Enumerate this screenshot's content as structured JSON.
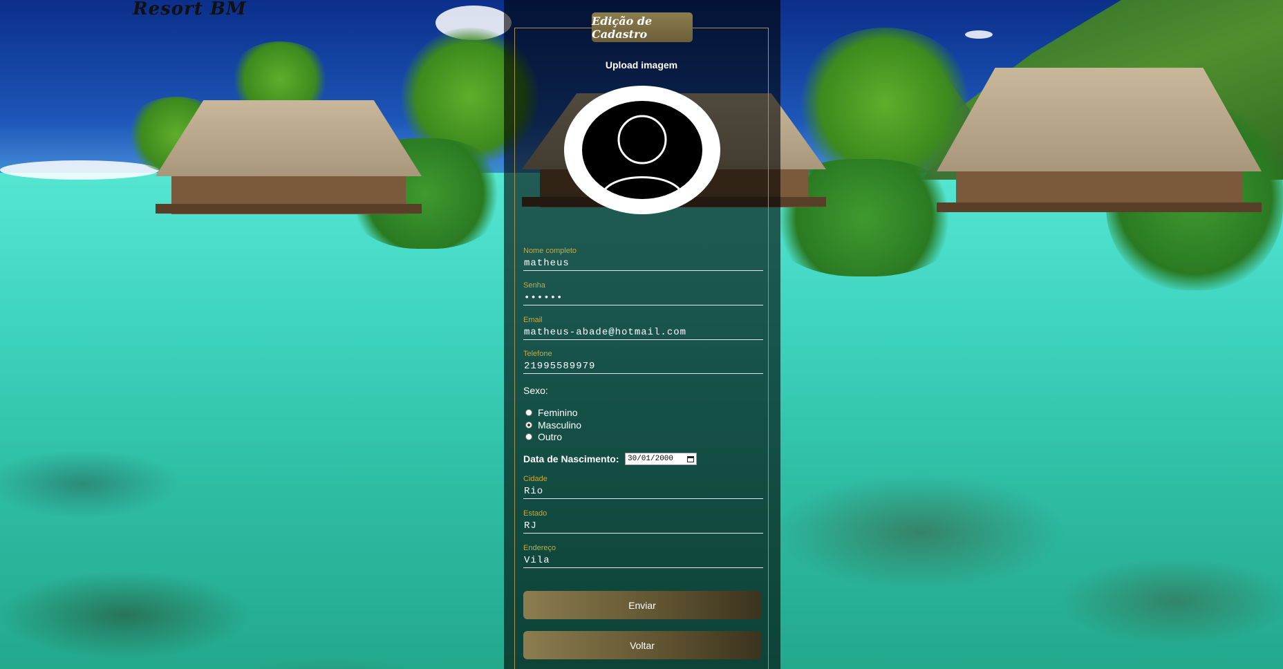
{
  "brand": "Resort BM",
  "form": {
    "legend": "Edição de Cadastro",
    "upload_label": "Upload imagem",
    "fields": {
      "nome": {
        "label": "Nome completo",
        "value": "matheus"
      },
      "senha": {
        "label": "Senha",
        "value": "••••••"
      },
      "email": {
        "label": "Email",
        "value": "matheus-abade@hotmail.com"
      },
      "telefone": {
        "label": "Telefone",
        "value": "21995589979"
      },
      "cidade": {
        "label": "Cidade",
        "value": "Rio"
      },
      "estado": {
        "label": "Estado",
        "value": "RJ"
      },
      "endereco": {
        "label": "Endereço",
        "value": "Vila"
      }
    },
    "sexo": {
      "title": "Sexo:",
      "options": [
        "Feminino",
        "Masculino",
        "Outro"
      ],
      "selected": "Masculino"
    },
    "nascimento": {
      "label": "Data de Nascimento:",
      "value": "30/01/2000"
    },
    "buttons": {
      "enviar": "Enviar",
      "voltar": "Voltar"
    }
  },
  "colors": {
    "accent": "#c9a93a",
    "button": "#8c7d4f",
    "frame": "#a89357"
  },
  "icons": {
    "avatar": "user-placeholder-icon",
    "calendar": "calendar-icon"
  }
}
